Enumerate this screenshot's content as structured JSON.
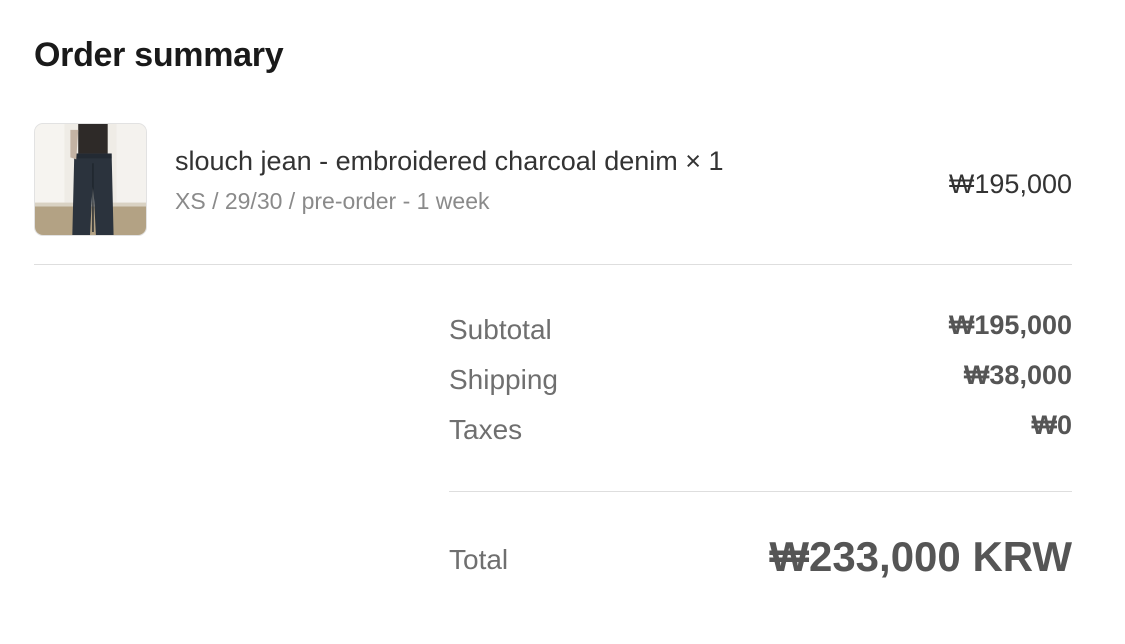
{
  "header": {
    "title": "Order summary"
  },
  "line_item": {
    "name": "slouch jean - embroidered charcoal denim × 1",
    "variant": "XS / 29/30 / pre-order - 1 week",
    "price": "₩195,000",
    "thumbnail_icon": "product-photo"
  },
  "totals": {
    "rows": [
      {
        "label": "Subtotal",
        "value": "₩195,000"
      },
      {
        "label": "Shipping",
        "value": "₩38,000"
      },
      {
        "label": "Taxes",
        "value": "₩0"
      }
    ],
    "total_label": "Total",
    "total_value": "₩233,000 KRW"
  },
  "colors": {
    "text_primary": "#333333",
    "text_muted": "#8a8a8a",
    "divider": "#dedede",
    "background": "#ffffff"
  }
}
